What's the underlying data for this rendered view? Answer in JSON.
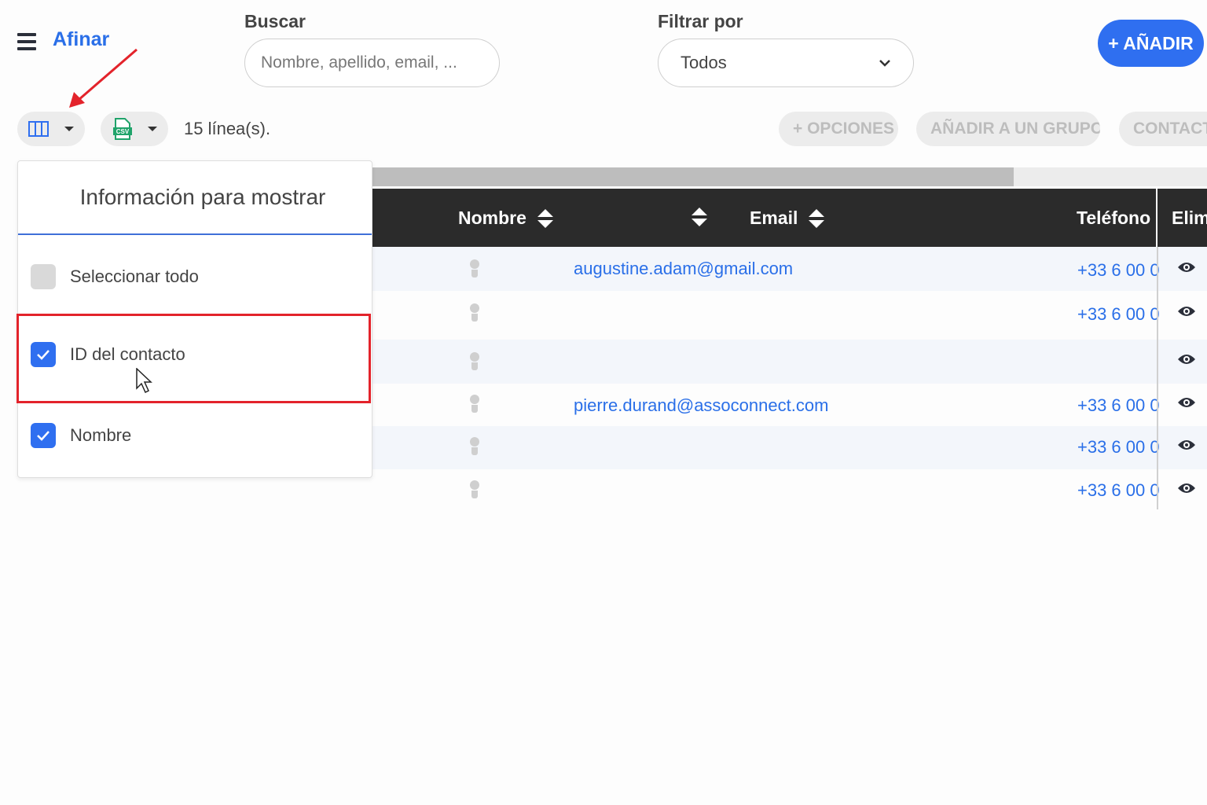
{
  "header": {
    "menu_icon": "hamburger-icon",
    "title": "Afinar",
    "search_label": "Buscar",
    "search_placeholder": "Nombre, apellido, email, ...",
    "filter_label": "Filtrar por",
    "filter_value": "Todos",
    "add_button": "+ AÑADIR"
  },
  "toolbar": {
    "columns_icon": "columns-icon",
    "export_icon": "csv-file-icon",
    "export_icon_text": "CSV",
    "line_count": "15 línea(s).",
    "options_button": "+ OPCIONES",
    "add_group_button": "AÑADIR A UN GRUPO",
    "contact_button": "CONTACT"
  },
  "table": {
    "headers": {
      "name": "Nombre",
      "email": "Email",
      "phone": "Teléfono",
      "delete": "Elimi"
    },
    "rows": [
      {
        "email": "augustine.adam@gmail.com",
        "phone": "+33 6 00 0"
      },
      {
        "email": "",
        "phone": "+33 6 00 0"
      },
      {
        "email": "",
        "phone": ""
      },
      {
        "email": "pierre.durand@assoconnect.com",
        "phone": "+33 6 00 0"
      },
      {
        "email": "",
        "phone": "+33 6 00 0"
      },
      {
        "email": "",
        "phone": "+33 6 00 0"
      }
    ]
  },
  "panel": {
    "title": "Información para mostrar",
    "options": [
      {
        "label": "Seleccionar todo",
        "checked": false
      },
      {
        "label": "ID del contacto",
        "checked": true
      },
      {
        "label": "Nombre",
        "checked": true
      }
    ]
  },
  "colors": {
    "accent": "#2f6ff0",
    "link": "#2a6fe8",
    "header_bg": "#2b2b2b",
    "highlight": "#e3232b"
  }
}
